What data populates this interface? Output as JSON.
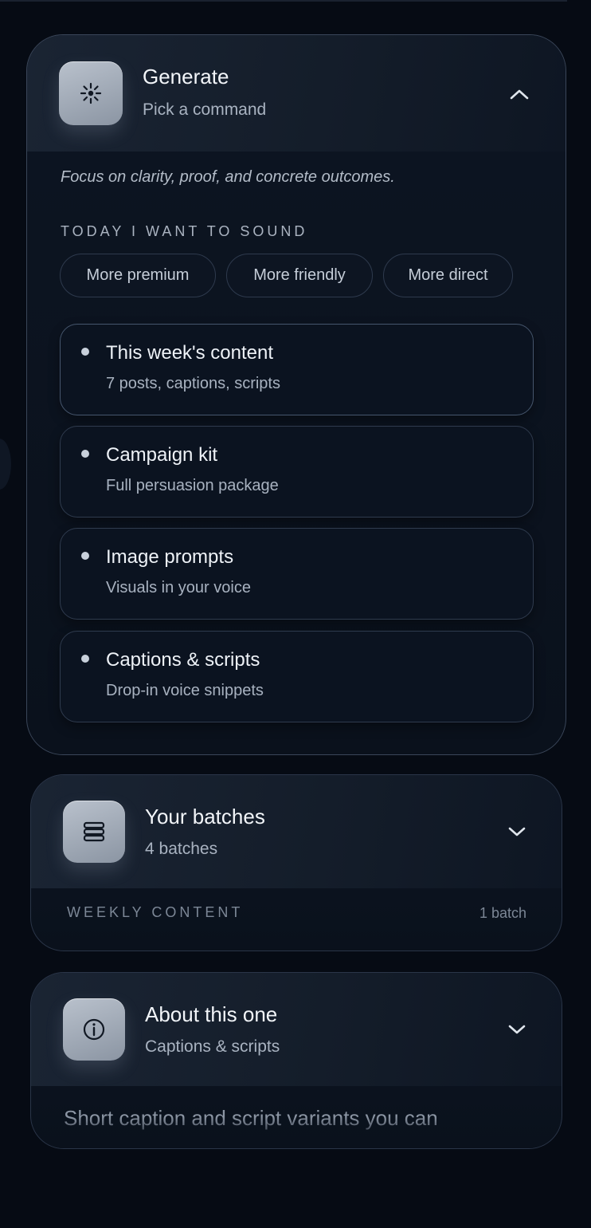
{
  "generate": {
    "title": "Generate",
    "subtitle": "Pick a command",
    "icon": "sparkle-icon",
    "expanded": true,
    "intro": "Focus on clarity, proof, and concrete outcomes.",
    "tone_label": "TODAY I WANT TO SOUND",
    "tones": [
      "More premium",
      "More friendly",
      "More direct"
    ],
    "commands": [
      {
        "title": "This week's content",
        "subtitle": "7 posts, captions, scripts"
      },
      {
        "title": "Campaign kit",
        "subtitle": "Full persuasion package"
      },
      {
        "title": "Image prompts",
        "subtitle": "Visuals in your voice"
      },
      {
        "title": "Captions & scripts",
        "subtitle": "Drop-in voice snippets"
      }
    ]
  },
  "batches": {
    "title": "Your batches",
    "subtitle": "4 batches",
    "icon": "stack-icon",
    "expanded": false,
    "section_label": "WEEKLY CONTENT",
    "section_count": "1 batch"
  },
  "about": {
    "title": "About this one",
    "subtitle": "Captions & scripts",
    "icon": "info-icon",
    "expanded": false,
    "body": "Short caption and script variants you can"
  },
  "colors": {
    "background": "#060b14",
    "panel": "#0d1522",
    "border": "#2a3548",
    "icon_tile": "#a3acb8"
  }
}
